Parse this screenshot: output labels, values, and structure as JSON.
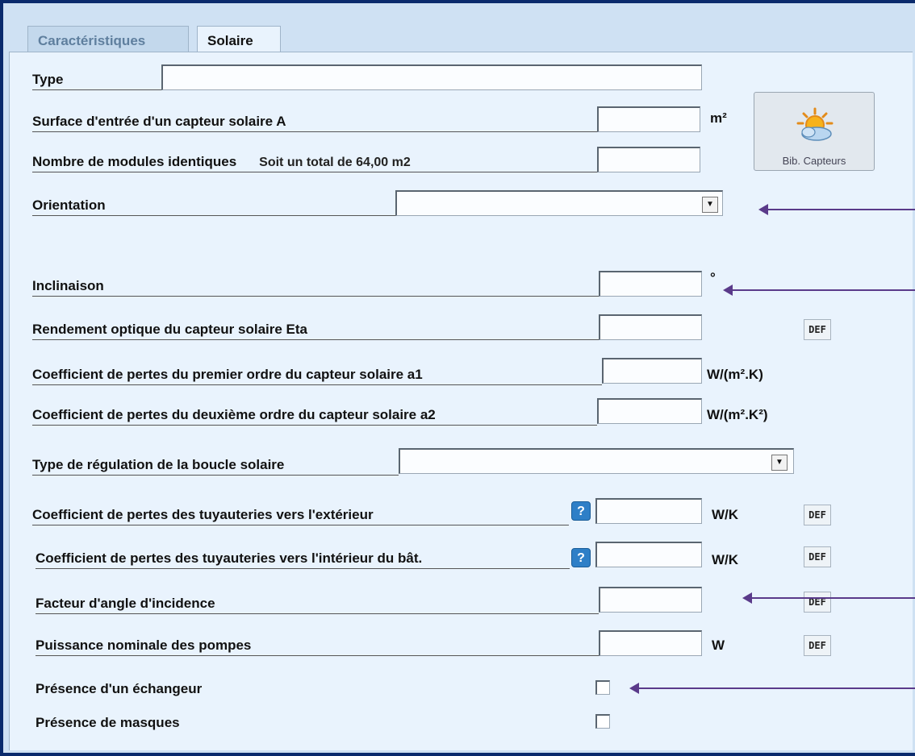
{
  "tabs": [
    {
      "label": "Caractéristiques",
      "active": false
    },
    {
      "label": "Solaire",
      "active": true
    }
  ],
  "fields": {
    "type": {
      "label": "Type",
      "value": ""
    },
    "surface": {
      "label": "Surface d'entrée d'un capteur solaire  A",
      "value": "",
      "unit": "m²"
    },
    "modules": {
      "label": "Nombre de modules identiques",
      "note": "Soit un total de 64,00 m2",
      "value": ""
    },
    "orientation": {
      "label": "Orientation",
      "selected": ""
    },
    "inclinaison": {
      "label": "Inclinaison",
      "value": "",
      "unit": "°"
    },
    "rendement": {
      "label": "Rendement optique du capteur solaire   Eta",
      "value": ""
    },
    "a1": {
      "label": "Coefficient de pertes du premier ordre du capteur solaire a1",
      "value": "",
      "unit": "W/(m².K)"
    },
    "a2": {
      "label": "Coefficient de pertes du deuxième ordre du capteur solaire a2",
      "value": "",
      "unit": "W/(m².K²)"
    },
    "regulation": {
      "label": "Type de régulation de la boucle solaire",
      "selected": ""
    },
    "pertes_ext": {
      "label": "Coefficient de pertes des tuyauteries vers l'extérieur",
      "value": "",
      "unit": "W/K"
    },
    "pertes_int": {
      "label": "Coefficient de pertes des tuyauteries vers l'intérieur du bât.",
      "value": "",
      "unit": "W/K"
    },
    "facteur_angle": {
      "label": "Facteur d'angle d'incidence",
      "value": ""
    },
    "puissance_pompes": {
      "label": "Puissance nominale des pompes",
      "value": "",
      "unit": "W"
    },
    "echangeur": {
      "label": "Présence d'un échangeur",
      "checked": false
    },
    "masques": {
      "label": "Présence de masques",
      "checked": false
    }
  },
  "buttons": {
    "bib_capteurs": "Bib. Capteurs",
    "def": "DEF",
    "help": "?",
    "dropdown": "▼"
  },
  "icons": {
    "library": "sun-cloud-icon",
    "help": "help-icon"
  },
  "colors": {
    "frame": "#0a2a6c",
    "panel": "#e9f3fd",
    "annotation_arrow": "#5a3a8a",
    "help_blue": "#2e7fc7"
  }
}
